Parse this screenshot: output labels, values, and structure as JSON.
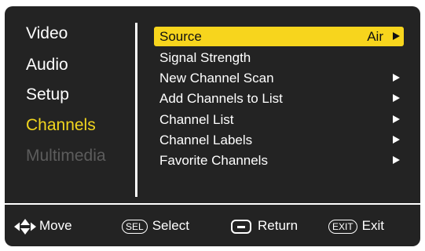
{
  "left_menu": {
    "items": [
      {
        "label": "Video",
        "state": "normal"
      },
      {
        "label": "Audio",
        "state": "normal"
      },
      {
        "label": "Setup",
        "state": "normal"
      },
      {
        "label": "Channels",
        "state": "active"
      },
      {
        "label": "Multimedia",
        "state": "disabled"
      }
    ]
  },
  "right_menu": {
    "items": [
      {
        "label": "Source",
        "value": "Air",
        "has_arrow": true,
        "selected": true
      },
      {
        "label": "Signal Strength",
        "value": "",
        "has_arrow": false,
        "selected": false
      },
      {
        "label": "New Channel Scan",
        "value": "",
        "has_arrow": true,
        "selected": false
      },
      {
        "label": "Add Channels to List",
        "value": "",
        "has_arrow": true,
        "selected": false
      },
      {
        "label": "Channel List",
        "value": "",
        "has_arrow": true,
        "selected": false
      },
      {
        "label": "Channel Labels",
        "value": "",
        "has_arrow": true,
        "selected": false
      },
      {
        "label": "Favorite Channels",
        "value": "",
        "has_arrow": true,
        "selected": false
      }
    ]
  },
  "footer": {
    "move_label": "Move",
    "sel_key": "SEL",
    "select_label": "Select",
    "return_label": "Return",
    "exit_key": "EXIT",
    "exit_label": "Exit"
  },
  "colors": {
    "background": "#232323",
    "highlight": "#f7d51d",
    "active_text": "#f1d61e",
    "disabled_text": "#5c5c5c"
  }
}
